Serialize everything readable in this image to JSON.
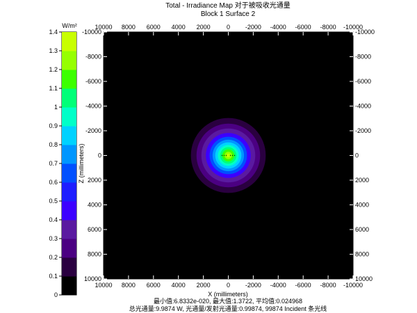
{
  "chart_data": {
    "type": "heatmap",
    "title": "Total - Irradiance Map 对于被吸收光通量",
    "subtitle": "Block 1 Surface 2",
    "xlabel": "X (millimeters)",
    "ylabel": "Z (millimeters)",
    "xlim": [
      10000,
      -10000
    ],
    "ylim": [
      -10000,
      10000
    ],
    "x_ticks": [
      "10000",
      "8000",
      "6000",
      "4000",
      "2000",
      "0",
      "-2000",
      "-4000",
      "-6000",
      "-8000",
      "-10000"
    ],
    "y_ticks": [
      "-10000",
      "-8000",
      "-6000",
      "-4000",
      "-2000",
      "0",
      "2000",
      "4000",
      "6000",
      "8000",
      "10000"
    ],
    "background_color": "#000000",
    "spot": {
      "center_x": 0,
      "center_z": 0,
      "outer_radius": 3000,
      "peak_value": 1.3722
    },
    "colorbar": {
      "unit": "W/m²",
      "range": [
        0,
        1.4
      ],
      "tick_labels": [
        "0",
        "0.1",
        "0.2",
        "0.3",
        "0.4",
        "0.5",
        "0.6",
        "0.7",
        "0.8",
        "0.9",
        "1",
        "1.1",
        "1.2",
        "1.3",
        "1.4"
      ],
      "colors": [
        "#000000",
        "#2a0040",
        "#4b0082",
        "#5a1aa0",
        "#3c00ff",
        "#1e1eff",
        "#0050ff",
        "#0096ff",
        "#00d2ff",
        "#00ffc8",
        "#00ff78",
        "#3cff00",
        "#96ff00",
        "#c8ff00"
      ]
    },
    "stats_line1": "最小值:6.8332e-020, 最大值:1.3722, 平均值:0.024968",
    "stats_line2": "总光通量:9.9874 W, 光通量/发射光通量:0.99874, 99874 Incident 条光线"
  }
}
